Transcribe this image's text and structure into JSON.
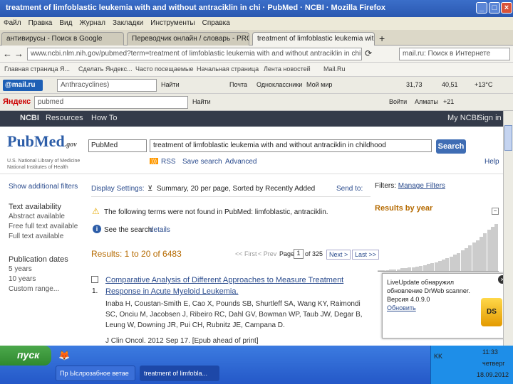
{
  "window": {
    "title": "treatment of limfoblastic leukemia with and without antraciklin in chi · PubMed · NCBI · Mozilla Firefox"
  },
  "menu": [
    "Файл",
    "Правка",
    "Вид",
    "Журнал",
    "Закладки",
    "Инструменты",
    "Справка"
  ],
  "tabs": [
    {
      "label": "антивирусы - Поиск в Google"
    },
    {
      "label": "Переводчик онлайн / словарь - PROMT"
    },
    {
      "label": "treatment of limfoblastic leukemia with an"
    }
  ],
  "nav": {
    "url": "www.ncbi.nlm.nih.gov/pubmed?term=treatment of limfoblastic leukemia with and without antraciklin in childhood",
    "search_placeholder": "mail.ru: Поиск в Интернете"
  },
  "bookmarks": [
    "Главная страница Я...",
    "Сделать Яндекс...",
    "Часто посещаемые",
    "Начальная страница",
    "Лента новостей",
    "Mail.Ru"
  ],
  "mailbar": {
    "query": "Anthracyclines)",
    "find": "Найти",
    "mail": "Почта",
    "ok": "Одноклассники",
    "moimir": "Мой мир",
    "weather": "+13°C",
    "rate1": "31,73",
    "rate2": "40,51"
  },
  "yabar": {
    "query": "pubmed",
    "find": "Найти",
    "login": "Войти",
    "city": "Алматы",
    "temp": "+21"
  },
  "ncbi": {
    "logo": "NCBI",
    "resources": "Resources",
    "howto": "How To",
    "myncbi": "My NCBI",
    "signin": "Sign in"
  },
  "pubmed": {
    "logo_pub": "Pub",
    "logo_med": "Med",
    "logo_gov": ".gov",
    "sub": "U.S. National Library of Medicine National Institutes of Health",
    "db": "PubMed",
    "query": "treatment of limfoblastic leukemia with and without antraciklin in childhood",
    "search_button": "Search",
    "rss": "RSS",
    "save_search": "Save search",
    "advanced": "Advanced",
    "help": "Help"
  },
  "left": {
    "show_filters": "Show additional filters",
    "text_avail": "Text availability",
    "abstract": "Abstract available",
    "freefull": "Free full text available",
    "fulltext": "Full text available",
    "pubdates": "Publication dates",
    "y5": "5 years",
    "y10": "10 years",
    "custom": "Custom range..."
  },
  "display": {
    "settings_label": "Display Settings:",
    "settings_value": "Summary, 20 per page, Sorted by Recently Added",
    "send_to": "Send to:"
  },
  "warning": "The following terms were not found in PubMed: limfoblastic, antraciklin.",
  "info": {
    "see": "See the search",
    "details": "details"
  },
  "results": {
    "label": "Results: 1 to 20 of 6483",
    "first": "<< First",
    "prev": "< Prev",
    "page_label": "Page",
    "page_value": "1",
    "of_pages": "of 325",
    "next": "Next >",
    "last": "Last >>"
  },
  "article": {
    "number": "1.",
    "title": "Comparative Analysis of Different Approaches to Measure Treatment Response in Acute Myeloid Leukemia.",
    "authors": "Inaba H, Coustan-Smith E, Cao X, Pounds SB, Shurtleff SA, Wang KY, Raimondi SC, Onciu M, Jacobsen J, Ribeiro RC, Dahl GV, Bowman WP, Taub JW, Degar B, Leung W, Downing JR, Pui CH, Rubnitz JE, Campana D.",
    "journal": "J Clin Oncol. 2012 Sep 17. [Epub ahead of print]"
  },
  "right": {
    "filters_label": "Filters:",
    "manage": "Manage Filters",
    "by_year": "Results by year"
  },
  "histogram": [
    1,
    1,
    1,
    2,
    2,
    2,
    3,
    3,
    4,
    4,
    5,
    6,
    7,
    8,
    9,
    10,
    12,
    13,
    15,
    17,
    19,
    21,
    24,
    27,
    30,
    33,
    36,
    40,
    44,
    48,
    52,
    55
  ],
  "popup": {
    "text": "LiveUpdate обнаружил обновление DrWeb scanner. Версия 4.0.9.0",
    "link": "Обновить"
  },
  "taskbar": {
    "start": "пуск",
    "task1": "Пр Ыслрозабное ветае",
    "task2": "treatment of limfobla...",
    "lang": "KK",
    "time": "11:33",
    "day": "четверг",
    "date": "18.09.2012"
  }
}
